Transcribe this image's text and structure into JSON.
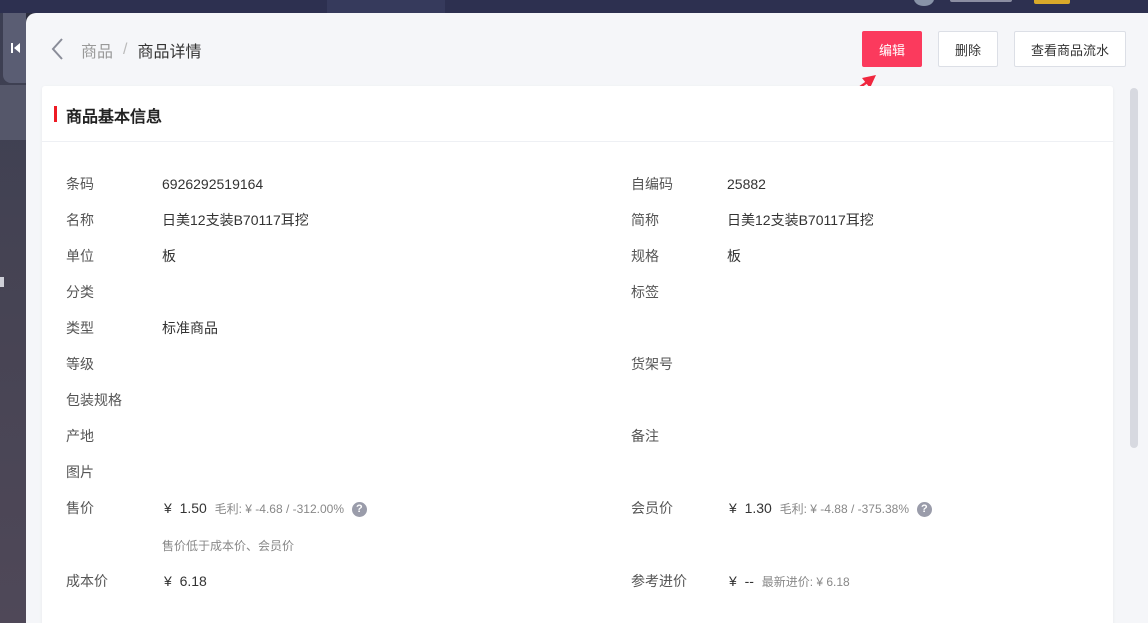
{
  "breadcrumb": {
    "parent": "商品",
    "separator": "/",
    "current": "商品详情"
  },
  "actions": {
    "edit": "编辑",
    "delete": "删除",
    "view_flow": "查看商品流水"
  },
  "card": {
    "title": "商品基本信息"
  },
  "fields": {
    "barcode": {
      "label": "条码",
      "value": "6926292519164"
    },
    "self_code": {
      "label": "自编码",
      "value": "25882"
    },
    "name": {
      "label": "名称",
      "value": "日美12支装B70117耳挖"
    },
    "short_name": {
      "label": "简称",
      "value": "日美12支装B70117耳挖"
    },
    "unit": {
      "label": "单位",
      "value": "板"
    },
    "spec": {
      "label": "规格",
      "value": "板"
    },
    "category": {
      "label": "分类",
      "value": ""
    },
    "tag": {
      "label": "标签",
      "value": ""
    },
    "type": {
      "label": "类型",
      "value": "标准商品"
    },
    "grade": {
      "label": "等级",
      "value": ""
    },
    "shelf_no": {
      "label": "货架号",
      "value": ""
    },
    "package_spec": {
      "label": "包装规格",
      "value": ""
    },
    "origin": {
      "label": "产地",
      "value": ""
    },
    "remark": {
      "label": "备注",
      "value": ""
    },
    "image": {
      "label": "图片",
      "value": ""
    },
    "sale_price": {
      "label": "售价",
      "currency": "¥",
      "value": "1.50",
      "margin_text": "毛利: ¥  -4.68 / -312.00%",
      "warning": "售价低于成本价、会员价"
    },
    "member_price": {
      "label": "会员价",
      "currency": "¥",
      "value": "1.30",
      "margin_text": "毛利: ¥  -4.88 / -375.38%"
    },
    "cost_price": {
      "label": "成本价",
      "currency": "¥",
      "value": "6.18"
    },
    "ref_purchase": {
      "label": "参考进价",
      "currency": "¥",
      "value": "--",
      "latest_text": "最新进价: ¥  6.18"
    }
  },
  "icons": {
    "back": "chevron-left-icon",
    "collapse": "collapse-left-icon",
    "help": "question-circle-icon",
    "help_glyph": "?"
  },
  "colors": {
    "accent": "#fb3a5d",
    "title_bar": "#ee1b24"
  }
}
